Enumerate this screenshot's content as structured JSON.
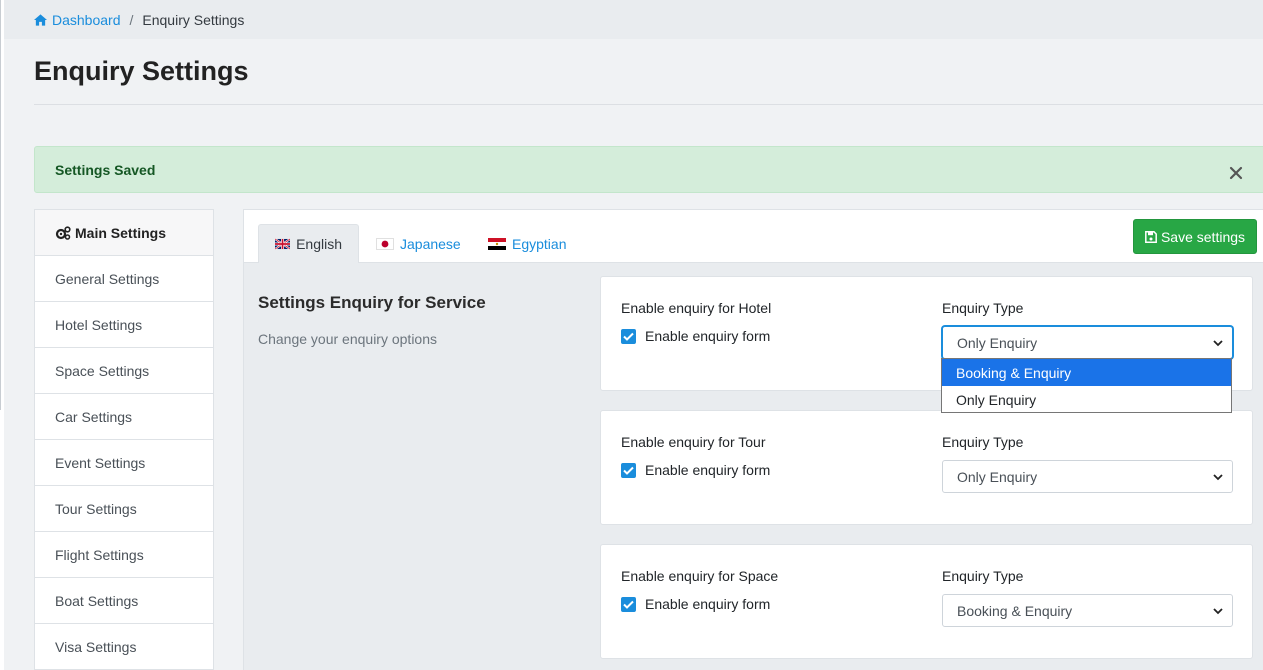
{
  "breadcrumb": {
    "home_label": "Dashboard",
    "separator": "/",
    "current": "Enquiry Settings"
  },
  "page": {
    "title": "Enquiry Settings"
  },
  "alert": {
    "message": "Settings Saved",
    "close_icon": "close-icon"
  },
  "sidebar": {
    "header": "Main Settings",
    "items": [
      {
        "label": "General Settings"
      },
      {
        "label": "Hotel Settings"
      },
      {
        "label": "Space Settings"
      },
      {
        "label": "Car Settings"
      },
      {
        "label": "Event Settings"
      },
      {
        "label": "Tour Settings"
      },
      {
        "label": "Flight Settings"
      },
      {
        "label": "Boat Settings"
      },
      {
        "label": "Visa Settings"
      }
    ]
  },
  "tabs": [
    {
      "label": "English",
      "flag": "uk-flag-icon",
      "active": true
    },
    {
      "label": "Japanese",
      "flag": "japan-flag-icon",
      "active": false
    },
    {
      "label": "Egyptian",
      "flag": "egypt-flag-icon",
      "active": false
    }
  ],
  "toolbar": {
    "save_label": "Save settings"
  },
  "section": {
    "title": "Settings Enquiry for Service",
    "subtitle": "Change your enquiry options"
  },
  "cards": [
    {
      "label": "Enable enquiry for Hotel",
      "checkbox_label": "Enable enquiry form",
      "checked": true,
      "type_label": "Enquiry Type",
      "selected": "Only Enquiry"
    },
    {
      "label": "Enable enquiry for Tour",
      "checkbox_label": "Enable enquiry form",
      "checked": true,
      "type_label": "Enquiry Type",
      "selected": "Only Enquiry"
    },
    {
      "label": "Enable enquiry for Space",
      "checkbox_label": "Enable enquiry form",
      "checked": true,
      "type_label": "Enquiry Type",
      "selected": "Booking & Enquiry"
    }
  ],
  "dropdown": {
    "options": [
      {
        "label": "Booking & Enquiry",
        "highlighted": true
      },
      {
        "label": "Only Enquiry",
        "highlighted": false
      }
    ]
  },
  "colors": {
    "accent": "#1a8ddc",
    "success": "#28a745",
    "alert_bg": "#d4edda",
    "alert_text": "#155724"
  }
}
